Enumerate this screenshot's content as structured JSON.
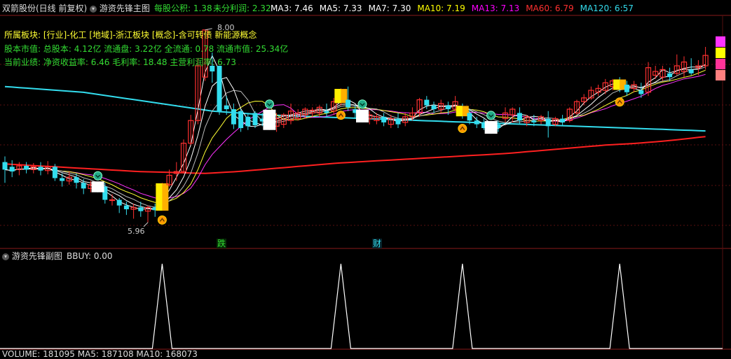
{
  "header": {
    "stock_name": "双箭股份(日线 前复权)",
    "indicator_name": "游资先锋主图",
    "eps_label": "每股公积: 1.38",
    "undistributed_label": "未分利润: 2.32",
    "ma_values": [
      {
        "label": "MA3: 7.46",
        "color": "#ffffff"
      },
      {
        "label": "MA5: 7.33",
        "color": "#ffffff"
      },
      {
        "label": "MA7: 7.30",
        "color": "#ffffff"
      },
      {
        "label": "MA10: 7.19",
        "color": "#ffff00"
      },
      {
        "label": "MA13: 7.13",
        "color": "#ff00ff"
      },
      {
        "label": "MA60: 6.79",
        "color": "#ff3030"
      },
      {
        "label": "MA120: 6:57",
        "color": "#33ddee"
      }
    ]
  },
  "info": {
    "sector_line": "所属板块: [行业]-化工 [地域]-浙江板块 [概念]-含可转债 新能源概念",
    "capital_line": "股本市值: 总股本: 4.12亿 流通盘: 3.22亿 全流通: 0.78 流通市值: 25.34亿",
    "performance_line": "当前业绩: 净资收益率: 6.46 毛利率: 18.48 主营利润率: 6.73"
  },
  "price_marks": {
    "high_label": "8.00",
    "low_label": "5.96"
  },
  "event_marks": {
    "fall_label": "跌",
    "finance_label": "财"
  },
  "sub_panel": {
    "title": "游资先锋副图",
    "value_label": "BBUY: 0.00"
  },
  "volume_panel": {
    "label": "VOLUME: 181095 MA5: 187108 MA10: 168073"
  },
  "colors": {
    "up": "#ff3030",
    "down": "#33ddee",
    "ma120": "#33ddee",
    "ma60": "#ff2020",
    "text_green": "#33dd33",
    "text_yellow": "#ffff33",
    "axis": "#8a1a1a"
  },
  "chart_data": {
    "type": "candlestick",
    "candles": [
      {
        "o": 6.6,
        "c": 6.52,
        "h": 6.66,
        "l": 6.38
      },
      {
        "o": 6.55,
        "c": 6.5,
        "h": 6.62,
        "l": 6.44
      },
      {
        "o": 6.52,
        "c": 6.56,
        "h": 6.6,
        "l": 6.46
      },
      {
        "o": 6.56,
        "c": 6.52,
        "h": 6.6,
        "l": 6.48
      },
      {
        "o": 6.52,
        "c": 6.55,
        "h": 6.59,
        "l": 6.48
      },
      {
        "o": 6.55,
        "c": 6.51,
        "h": 6.6,
        "l": 6.46
      },
      {
        "o": 6.51,
        "c": 6.55,
        "h": 6.61,
        "l": 6.47
      },
      {
        "o": 6.55,
        "c": 6.43,
        "h": 6.58,
        "l": 6.4
      },
      {
        "o": 6.43,
        "c": 6.4,
        "h": 6.48,
        "l": 6.34
      },
      {
        "o": 6.4,
        "c": 6.44,
        "h": 6.5,
        "l": 6.36
      },
      {
        "o": 6.44,
        "c": 6.38,
        "h": 6.48,
        "l": 6.32
      },
      {
        "o": 6.38,
        "c": 6.32,
        "h": 6.42,
        "l": 6.26
      },
      {
        "o": 6.32,
        "c": 6.36,
        "h": 6.4,
        "l": 6.28
      },
      {
        "o": 6.36,
        "c": 6.32,
        "h": 6.38,
        "l": 6.28
      },
      {
        "o": 6.34,
        "c": 6.2,
        "h": 6.38,
        "l": 6.16
      },
      {
        "o": 6.2,
        "c": 6.2,
        "h": 6.26,
        "l": 6.14
      },
      {
        "o": 6.2,
        "c": 6.14,
        "h": 6.22,
        "l": 6.06
      },
      {
        "o": 6.14,
        "c": 6.1,
        "h": 6.18,
        "l": 6.04
      },
      {
        "o": 6.1,
        "c": 6.12,
        "h": 6.16,
        "l": 6.0
      },
      {
        "o": 6.12,
        "c": 6.08,
        "h": 6.18,
        "l": 6.02
      },
      {
        "o": 6.08,
        "c": 6.12,
        "h": 6.14,
        "l": 5.96
      },
      {
        "o": 6.12,
        "c": 6.09,
        "h": 6.16,
        "l": 6.02
      },
      {
        "o": 6.1,
        "c": 6.36,
        "h": 6.38,
        "l": 6.09
      },
      {
        "o": 6.36,
        "c": 6.46,
        "h": 6.52,
        "l": 6.34
      },
      {
        "o": 6.48,
        "c": 6.5,
        "h": 6.6,
        "l": 6.4
      },
      {
        "o": 6.5,
        "c": 6.8,
        "h": 6.84,
        "l": 6.48
      },
      {
        "o": 6.8,
        "c": 7.04,
        "h": 7.1,
        "l": 6.78
      },
      {
        "o": 7.04,
        "c": 7.62,
        "h": 7.7,
        "l": 7.0
      },
      {
        "o": 7.5,
        "c": 8.0,
        "h": 8.0,
        "l": 7.46
      },
      {
        "o": 7.62,
        "c": 7.56,
        "h": 7.76,
        "l": 7.44
      },
      {
        "o": 7.62,
        "c": 7.14,
        "h": 7.62,
        "l": 7.1
      },
      {
        "o": 7.2,
        "c": 7.16,
        "h": 7.3,
        "l": 7.1
      },
      {
        "o": 7.16,
        "c": 7.0,
        "h": 7.22,
        "l": 6.95
      },
      {
        "o": 7.14,
        "c": 6.96,
        "h": 7.16,
        "l": 6.92
      },
      {
        "o": 7.08,
        "c": 6.98,
        "h": 7.12,
        "l": 6.94
      },
      {
        "o": 7.12,
        "c": 6.99,
        "h": 7.14,
        "l": 6.96
      },
      {
        "o": 7.06,
        "c": 7.03,
        "h": 7.12,
        "l": 6.98
      },
      {
        "o": 7.0,
        "c": 7.1,
        "h": 7.14,
        "l": 6.94
      },
      {
        "o": 6.98,
        "c": 7.06,
        "h": 7.12,
        "l": 6.92
      },
      {
        "o": 7.0,
        "c": 7.1,
        "h": 7.12,
        "l": 6.96
      },
      {
        "o": 7.04,
        "c": 7.14,
        "h": 7.22,
        "l": 7.0
      },
      {
        "o": 7.06,
        "c": 7.12,
        "h": 7.16,
        "l": 7.04
      },
      {
        "o": 7.1,
        "c": 7.16,
        "h": 7.18,
        "l": 7.06
      },
      {
        "o": 7.12,
        "c": 7.15,
        "h": 7.18,
        "l": 7.08
      },
      {
        "o": 7.12,
        "c": 7.18,
        "h": 7.2,
        "l": 7.08
      },
      {
        "o": 7.14,
        "c": 7.12,
        "h": 7.22,
        "l": 7.08
      },
      {
        "o": 7.14,
        "c": 7.24,
        "h": 7.28,
        "l": 7.1
      },
      {
        "o": 7.24,
        "c": 7.36,
        "h": 7.38,
        "l": 7.2
      },
      {
        "o": 7.26,
        "c": 7.18,
        "h": 7.4,
        "l": 7.14
      },
      {
        "o": 7.16,
        "c": 7.12,
        "h": 7.2,
        "l": 7.06
      },
      {
        "o": 7.1,
        "c": 7.06,
        "h": 7.14,
        "l": 7.02
      },
      {
        "o": 7.06,
        "c": 7.1,
        "h": 7.14,
        "l": 7.0
      },
      {
        "o": 7.04,
        "c": 7.08,
        "h": 7.12,
        "l": 7.0
      },
      {
        "o": 7.08,
        "c": 7.02,
        "h": 7.12,
        "l": 6.98
      },
      {
        "o": 7.0,
        "c": 7.06,
        "h": 7.1,
        "l": 6.96
      },
      {
        "o": 7.06,
        "c": 7.0,
        "h": 7.12,
        "l": 6.96
      },
      {
        "o": 7.02,
        "c": 7.08,
        "h": 7.12,
        "l": 6.98
      },
      {
        "o": 7.08,
        "c": 7.12,
        "h": 7.18,
        "l": 7.04
      },
      {
        "o": 7.12,
        "c": 7.26,
        "h": 7.28,
        "l": 7.08
      },
      {
        "o": 7.26,
        "c": 7.2,
        "h": 7.3,
        "l": 7.16
      },
      {
        "o": 7.2,
        "c": 7.16,
        "h": 7.24,
        "l": 7.12
      },
      {
        "o": 7.16,
        "c": 7.22,
        "h": 7.26,
        "l": 7.12
      },
      {
        "o": 7.2,
        "c": 7.16,
        "h": 7.24,
        "l": 7.1
      },
      {
        "o": 7.16,
        "c": 7.24,
        "h": 7.3,
        "l": 7.14
      },
      {
        "o": 7.18,
        "c": 7.1,
        "h": 7.22,
        "l": 7.06
      },
      {
        "o": 7.12,
        "c": 7.04,
        "h": 7.16,
        "l": 7.0
      },
      {
        "o": 7.04,
        "c": 7.0,
        "h": 7.08,
        "l": 6.96
      },
      {
        "o": 7.02,
        "c": 6.96,
        "h": 7.06,
        "l": 6.94
      },
      {
        "o": 6.98,
        "c": 6.94,
        "h": 7.02,
        "l": 6.9
      },
      {
        "o": 7.0,
        "c": 6.96,
        "h": 7.04,
        "l": 6.92
      },
      {
        "o": 7.06,
        "c": 7.12,
        "h": 7.18,
        "l": 7.02
      },
      {
        "o": 7.1,
        "c": 7.16,
        "h": 7.18,
        "l": 7.02
      },
      {
        "o": 7.12,
        "c": 7.04,
        "h": 7.18,
        "l": 7.0
      },
      {
        "o": 7.02,
        "c": 7.08,
        "h": 7.1,
        "l": 6.98
      },
      {
        "o": 7.04,
        "c": 7.02,
        "h": 7.1,
        "l": 6.98
      },
      {
        "o": 7.04,
        "c": 7.08,
        "h": 7.1,
        "l": 7.0
      },
      {
        "o": 7.06,
        "c": 6.98,
        "h": 7.14,
        "l": 6.86
      },
      {
        "o": 7.0,
        "c": 7.06,
        "h": 7.08,
        "l": 6.98
      },
      {
        "o": 7.06,
        "c": 7.02,
        "h": 7.1,
        "l": 6.98
      },
      {
        "o": 7.04,
        "c": 7.16,
        "h": 7.18,
        "l": 7.02
      },
      {
        "o": 7.12,
        "c": 7.24,
        "h": 7.26,
        "l": 7.1
      },
      {
        "o": 7.24,
        "c": 7.28,
        "h": 7.32,
        "l": 7.2
      },
      {
        "o": 7.28,
        "c": 7.36,
        "h": 7.4,
        "l": 7.26
      },
      {
        "o": 7.34,
        "c": 7.38,
        "h": 7.42,
        "l": 7.3
      },
      {
        "o": 7.36,
        "c": 7.44,
        "h": 7.48,
        "l": 7.32
      },
      {
        "o": 7.4,
        "c": 7.46,
        "h": 7.48,
        "l": 7.36
      },
      {
        "o": 7.46,
        "c": 7.38,
        "h": 7.5,
        "l": 7.34
      },
      {
        "o": 7.42,
        "c": 7.34,
        "h": 7.46,
        "l": 7.3
      },
      {
        "o": 7.38,
        "c": 7.42,
        "h": 7.46,
        "l": 7.34
      },
      {
        "o": 7.36,
        "c": 7.32,
        "h": 7.44,
        "l": 7.28
      },
      {
        "o": 7.34,
        "c": 7.6,
        "h": 7.66,
        "l": 7.3
      },
      {
        "o": 7.52,
        "c": 7.56,
        "h": 7.62,
        "l": 7.48
      },
      {
        "o": 7.5,
        "c": 7.58,
        "h": 7.62,
        "l": 7.46
      },
      {
        "o": 7.54,
        "c": 7.5,
        "h": 7.6,
        "l": 7.46
      },
      {
        "o": 7.54,
        "c": 7.62,
        "h": 7.74,
        "l": 7.52
      },
      {
        "o": 7.56,
        "c": 7.66,
        "h": 7.72,
        "l": 7.5
      },
      {
        "o": 7.58,
        "c": 7.54,
        "h": 7.7,
        "l": 7.52
      },
      {
        "o": 7.6,
        "c": 7.62,
        "h": 7.68,
        "l": 7.52
      },
      {
        "o": 7.62,
        "c": 7.73,
        "h": 7.82,
        "l": 7.58
      }
    ],
    "ma120": [
      7.4,
      7.38,
      7.36,
      7.34,
      7.3,
      7.26,
      7.22,
      7.18,
      7.14,
      7.12,
      7.1,
      7.09,
      7.08,
      7.07,
      7.06,
      7.05,
      7.04,
      7.03,
      7.02,
      7.01,
      7.0,
      6.99,
      6.98,
      6.97,
      6.96,
      6.95,
      6.94,
      6.93
    ],
    "ma60": [
      6.58,
      6.56,
      6.54,
      6.52,
      6.5,
      6.49,
      6.48,
      6.5,
      6.53,
      6.56,
      6.59,
      6.61,
      6.63,
      6.65,
      6.67,
      6.69,
      6.72,
      6.75,
      6.78,
      6.8,
      6.83,
      6.87
    ],
    "ylim": [
      5.9,
      8.05
    ],
    "buy_signal_indices": [
      22,
      47,
      64,
      86
    ],
    "bbuy_value": 0.0,
    "bbuy_peaks_at": [
      22,
      47,
      64,
      86
    ]
  }
}
